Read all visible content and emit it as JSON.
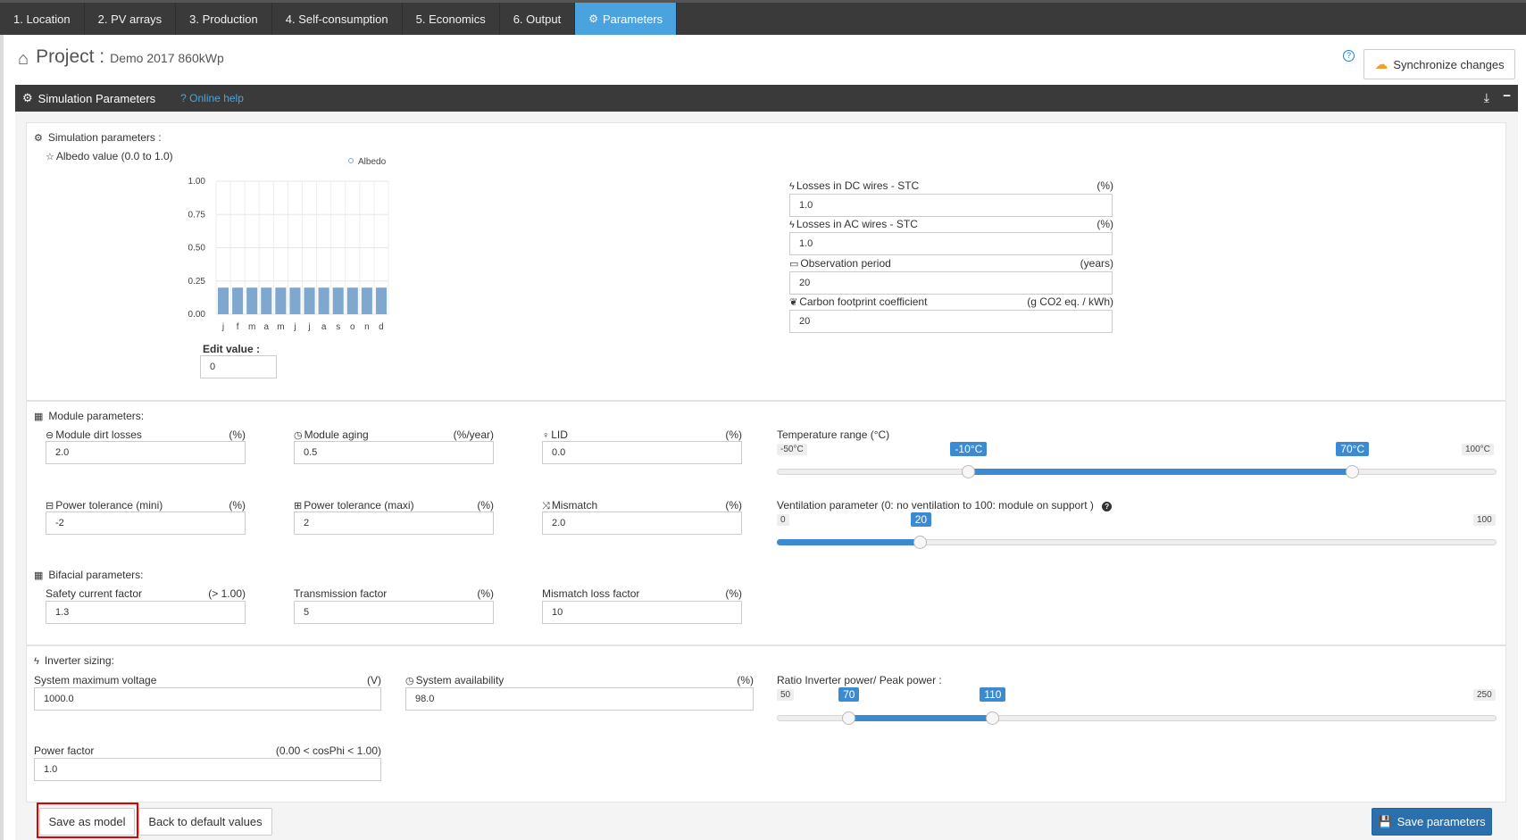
{
  "nav": {
    "tabs": [
      {
        "label": "1. Location"
      },
      {
        "label": "2. PV arrays"
      },
      {
        "label": "3. Production"
      },
      {
        "label": "4. Self-consumption"
      },
      {
        "label": "5. Economics"
      },
      {
        "label": "6. Output"
      },
      {
        "label": "Parameters",
        "active": true
      }
    ]
  },
  "project": {
    "title": "Project :",
    "name": "Demo 2017 860kWp"
  },
  "header": {
    "sync_label": "Synchronize changes",
    "help_symbol": "?"
  },
  "panel": {
    "title": "Simulation Parameters",
    "online_help": "Online help"
  },
  "simulation": {
    "section_title": "Simulation parameters :",
    "albedo_label": "Albedo value (0.0 to 1.0)",
    "edit_label": "Edit value :",
    "edit_value": "0",
    "dc_wires_label": "Losses in DC wires - STC",
    "dc_wires_unit": "(%)",
    "dc_wires_value": "1.0",
    "ac_wires_label": "Losses in AC wires - STC",
    "ac_wires_unit": "(%)",
    "ac_wires_value": "1.0",
    "observation_label": "Observation period",
    "observation_unit": "(years)",
    "observation_value": "20",
    "carbon_label": "Carbon footprint coefficient",
    "carbon_unit": "(g CO2 eq. / kWh)",
    "carbon_value": "20"
  },
  "chart_data": {
    "type": "bar",
    "categories": [
      "j",
      "f",
      "m",
      "a",
      "m",
      "j",
      "j",
      "a",
      "s",
      "o",
      "n",
      "d"
    ],
    "series": [
      {
        "name": "Albedo",
        "values": [
          0.2,
          0.2,
          0.2,
          0.2,
          0.2,
          0.2,
          0.2,
          0.2,
          0.2,
          0.2,
          0.2,
          0.2
        ]
      }
    ],
    "yticks": [
      "1.00",
      "0.75",
      "0.50",
      "0.25",
      "0.00"
    ],
    "ylim": [
      0,
      1
    ],
    "grid": true,
    "legend": "top-right",
    "bar_color": "#7fa8d0"
  },
  "module": {
    "section_title": "Module parameters:",
    "dirt_label": "Module dirt losses",
    "dirt_unit": "(%)",
    "dirt_value": "2.0",
    "aging_label": "Module aging",
    "aging_unit": "(%/year)",
    "aging_value": "0.5",
    "lid_label": "LID",
    "lid_unit": "(%)",
    "lid_value": "0.0",
    "tol_min_label": "Power tolerance (mini)",
    "tol_min_unit": "(%)",
    "tol_min_value": "-2",
    "tol_max_label": "Power tolerance (maxi)",
    "tol_max_unit": "(%)",
    "tol_max_value": "2",
    "mismatch_label": "Mismatch",
    "mismatch_unit": "(%)",
    "mismatch_value": "2.0",
    "temp_label": "Temperature range (°C)",
    "temp_min": "-50°C",
    "temp_max": "100°C",
    "temp_low": "-10°C",
    "temp_high": "70°C",
    "temp_range": [
      -50,
      100
    ],
    "temp_values": [
      -10,
      70
    ],
    "vent_label": "Ventilation parameter (0: no ventilation to 100: module on support )",
    "vent_min": "0",
    "vent_max": "100",
    "vent_value_label": "20",
    "vent_value": 20
  },
  "bifacial": {
    "section_title": "Bifacial parameters:",
    "safety_label": "Safety current factor",
    "safety_unit": "(> 1.00)",
    "safety_value": "1.3",
    "transmission_label": "Transmission factor",
    "transmission_unit": "(%)",
    "transmission_value": "5",
    "mismatch_loss_label": "Mismatch loss factor",
    "mismatch_loss_unit": "(%)",
    "mismatch_loss_value": "10"
  },
  "inverter": {
    "section_title": "Inverter sizing:",
    "voltage_label": "System maximum voltage",
    "voltage_unit": "(V)",
    "voltage_value": "1000.0",
    "availability_label": "System availability",
    "availability_unit": "(%)",
    "availability_value": "98.0",
    "ratio_label": "Ratio Inverter power/ Peak power :",
    "ratio_min": "50",
    "ratio_max": "250",
    "ratio_low_label": "70",
    "ratio_high_label": "110",
    "ratio_range": [
      50,
      250
    ],
    "ratio_values": [
      70,
      110
    ],
    "pf_label": "Power factor",
    "pf_unit": "(0.00 < cosPhi < 1.00)",
    "pf_value": "1.0"
  },
  "buttons": {
    "save_model": "Save as model",
    "default_values": "Back to default values",
    "save_params": "Save parameters"
  },
  "colors": {
    "accent": "#4aa3df",
    "slider": "#3c8ad1",
    "primary_button": "#2a6fae",
    "highlight": "#e00000"
  }
}
